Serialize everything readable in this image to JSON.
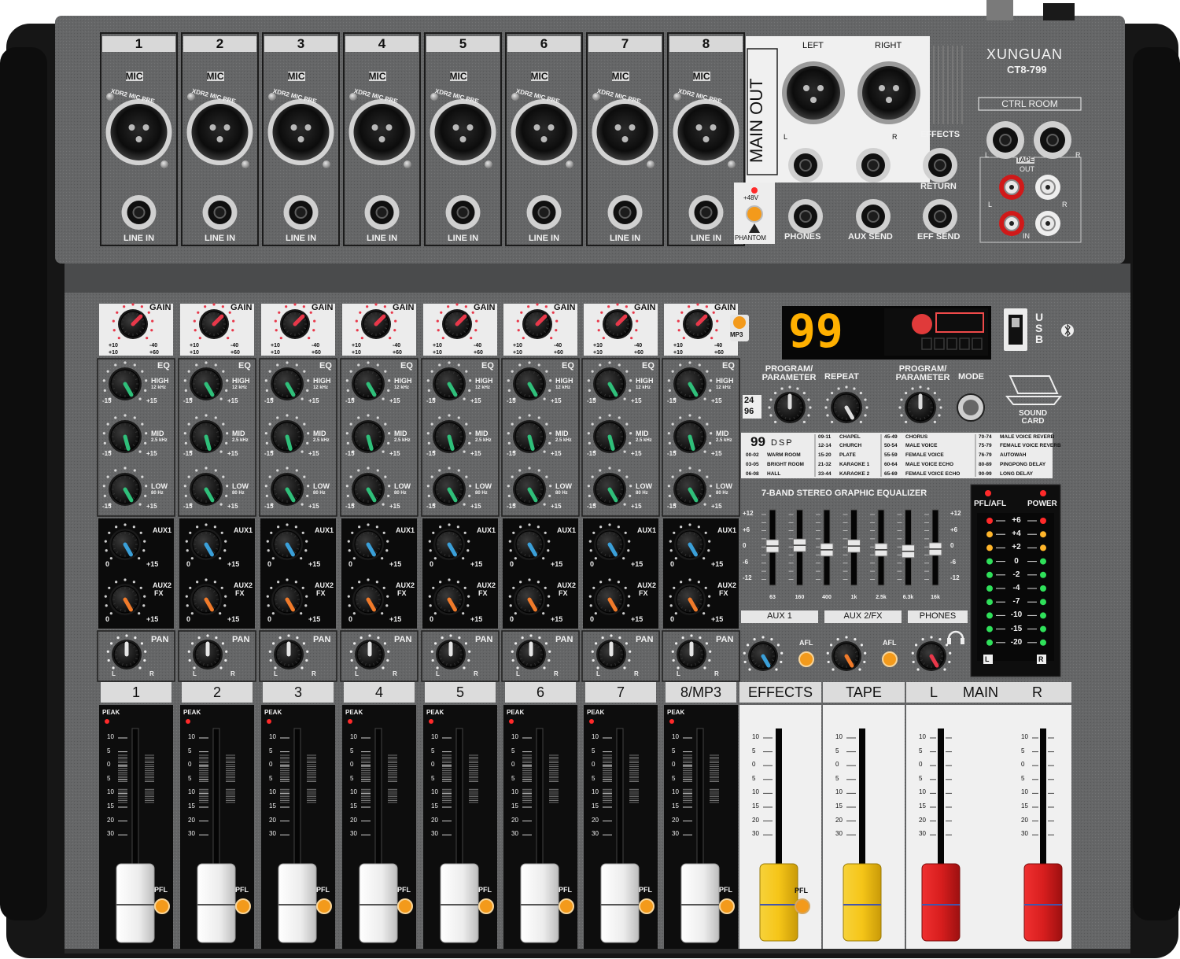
{
  "brand": {
    "name": "XUNGUAN",
    "model": "CT8-799"
  },
  "channels": [
    "1",
    "2",
    "3",
    "4",
    "5",
    "6",
    "7",
    "8"
  ],
  "channel_labels": {
    "mic": "MIC",
    "preamp": "XDR2 MIC PRE",
    "line_in": "LINE IN"
  },
  "main_out": {
    "title": "MAIN OUT",
    "left": "LEFT",
    "right": "RIGHT",
    "l": "L",
    "r": "R"
  },
  "phantom": {
    "voltage": "+48V",
    "label": "PHANTOM"
  },
  "rear_jacks": {
    "phones": "PHONES",
    "aux_send": "AUX SEND",
    "effects": "EFFECTS",
    "return": "RETURN",
    "eff_send": "EFF SEND"
  },
  "ctrl_room": {
    "title": "CTRL ROOM",
    "tape": "TAPE",
    "out": "OUT",
    "in": "IN",
    "l": "L",
    "r": "R"
  },
  "strip": {
    "gain": "GAIN",
    "gain_min": "+10",
    "gain_max": "-40",
    "gain_min2": "+10",
    "gain_max2": "+60",
    "eq": "EQ",
    "high": "HIGH",
    "high_freq": "12 kHz",
    "mid": "MID",
    "mid_freq": "2.5 kHz",
    "low": "LOW",
    "low_freq": "80 Hz",
    "minus15": "-15",
    "plus15": "+15",
    "aux1": "AUX1",
    "aux2": "AUX2",
    "fx": "FX",
    "zero": "0",
    "pan": "PAN",
    "l": "L",
    "r": "R",
    "peak": "PEAK",
    "pfl": "PFL"
  },
  "mp3": "MP3",
  "display": {
    "number": "99",
    "usb": "USB"
  },
  "dsp": {
    "program1": "PROGRAM/ PARAMETER",
    "repeat": "REPEAT",
    "program2": "PROGRAM/ PARAMETER",
    "mode": "MODE",
    "bits1": "24",
    "bits2": "96",
    "sound_card": "SOUND CARD",
    "logo_num": "99",
    "logo_text": "DSP"
  },
  "effects_table": [
    [
      "00-02",
      "WARM ROOM"
    ],
    [
      "03-05",
      "BRIGHT ROOM"
    ],
    [
      "06-08",
      "HALL"
    ],
    [
      "09-11",
      "CHAPEL"
    ],
    [
      "12-14",
      "CHURCH"
    ],
    [
      "15-20",
      "PLATE"
    ],
    [
      "21-32",
      "KARAOKE 1"
    ],
    [
      "33-44",
      "KARAOKE 2"
    ],
    [
      "45-49",
      "CHORUS"
    ],
    [
      "50-54",
      "MALE VOICE"
    ],
    [
      "55-59",
      "FEMALE VOICE"
    ],
    [
      "60-64",
      "MALE VOICE ECHO"
    ],
    [
      "65-69",
      "FEMALE VOICE ECHO"
    ],
    [
      "70-74",
      "MALE VOICE REVERB"
    ],
    [
      "75-79",
      "FEMALE VOICE REVERB"
    ],
    [
      "76-79",
      "AUTOWAH"
    ],
    [
      "80-89",
      "PINGPONG DELAY"
    ],
    [
      "90-99",
      "LONG DELAY"
    ]
  ],
  "geq": {
    "title": "7-BAND STEREO GRAPHIC EQUALIZER",
    "scale": [
      "+12",
      "+6",
      "0",
      "-6",
      "-12"
    ],
    "bands": [
      "63",
      "160",
      "400",
      "1k",
      "2.5k",
      "6.3k",
      "16k"
    ],
    "levels": [
      0.52,
      0.53,
      0.47,
      0.52,
      0.47,
      0.45,
      0.48
    ]
  },
  "meter": {
    "pfl_afl": "PFL/AFL",
    "power": "POWER",
    "scale": [
      "+6",
      "+4",
      "+2",
      "0",
      "-2",
      "-4",
      "-7",
      "-10",
      "-15",
      "-20"
    ],
    "l": "L",
    "r": "R"
  },
  "master": {
    "aux1": "AUX 1",
    "aux2fx": "AUX 2/FX",
    "phones": "PHONES",
    "afl": "AFL",
    "effects": "EFFECTS",
    "tape": "TAPE",
    "main_l": "L",
    "main": "MAIN",
    "main_r": "R",
    "main_label": "L   MAIN   R"
  },
  "channel_strip_labels": [
    "1",
    "2",
    "3",
    "4",
    "5",
    "6",
    "7",
    "8/MP3"
  ],
  "fader_scale": [
    "10",
    "5",
    "0",
    "5",
    "10",
    "15",
    "20",
    "30"
  ],
  "fader_levels": {
    "channels": [
      0.0,
      0.0,
      0.0,
      0.0,
      0.0,
      0.0,
      0.0,
      0.0
    ],
    "effects": 0.0,
    "tape": 0.0,
    "main_l": 0.0,
    "main_r": 0.0
  },
  "colors": {
    "body": "#646566",
    "face_top": "#5e5f60",
    "frame": "#161616",
    "eq_knob": "#2fbf7a",
    "aux1_knob": "#3a9fd8",
    "aux2_knob": "#f07a2a",
    "gain_knob": "#e8384a",
    "led_red": "#ff2a2a",
    "led_green": "#2fe05a",
    "seg_orange": "#ffb000",
    "fader_white": "#f4f4f4",
    "fader_yellow": "#f5c518",
    "fader_red": "#d81e1e",
    "pfl_orange": "#f39a1b"
  }
}
